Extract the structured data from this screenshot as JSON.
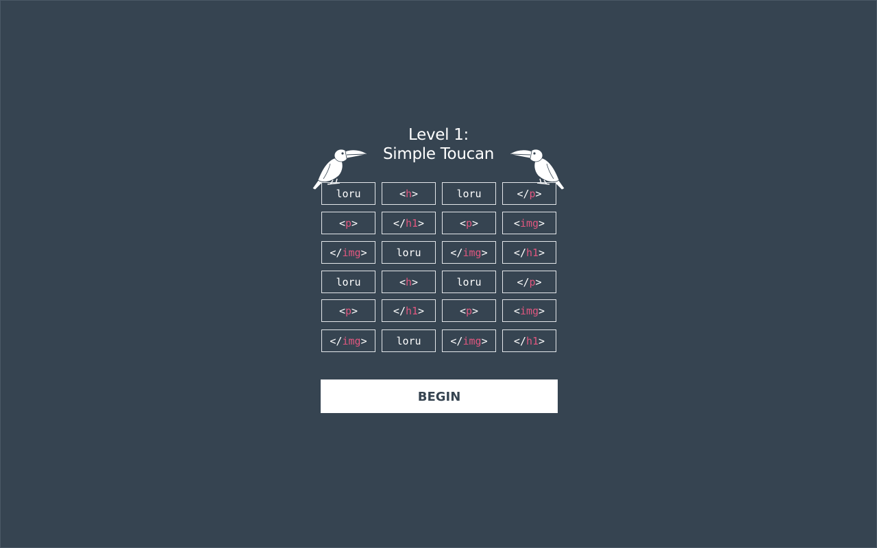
{
  "level": {
    "line1": "Level 1:",
    "line2": "Simple Toucan"
  },
  "board": {
    "rows": [
      [
        {
          "pre": "",
          "tag": "",
          "text": "loru"
        },
        {
          "pre": "<",
          "tag": "h",
          "post": ">"
        },
        {
          "pre": "",
          "tag": "",
          "text": "loru"
        },
        {
          "pre": "</",
          "tag": "p",
          "post": ">"
        }
      ],
      [
        {
          "pre": "<",
          "tag": "p",
          "post": ">"
        },
        {
          "pre": "</",
          "tag": "h1",
          "post": ">"
        },
        {
          "pre": "<",
          "tag": "p",
          "post": ">"
        },
        {
          "pre": "<",
          "tag": "img",
          "post": ">"
        }
      ],
      [
        {
          "pre": "</",
          "tag": "img",
          "post": ">"
        },
        {
          "pre": "",
          "tag": "",
          "text": "loru"
        },
        {
          "pre": "</",
          "tag": "img",
          "post": ">"
        },
        {
          "pre": "</",
          "tag": "h1",
          "post": ">"
        }
      ],
      [
        {
          "pre": "",
          "tag": "",
          "text": "loru"
        },
        {
          "pre": "<",
          "tag": "h",
          "post": ">"
        },
        {
          "pre": "",
          "tag": "",
          "text": "loru"
        },
        {
          "pre": "</",
          "tag": "p",
          "post": ">"
        }
      ],
      [
        {
          "pre": "<",
          "tag": "p",
          "post": ">"
        },
        {
          "pre": "</",
          "tag": "h1",
          "post": ">"
        },
        {
          "pre": "<",
          "tag": "p",
          "post": ">"
        },
        {
          "pre": "<",
          "tag": "img",
          "post": ">"
        }
      ],
      [
        {
          "pre": "</",
          "tag": "img",
          "post": ">"
        },
        {
          "pre": "",
          "tag": "",
          "text": "loru"
        },
        {
          "pre": "</",
          "tag": "img",
          "post": ">"
        },
        {
          "pre": "</",
          "tag": "h1",
          "post": ">"
        }
      ]
    ]
  },
  "begin_label": "BEGIN",
  "colors": {
    "background": "#364451",
    "tag_accent": "#e0577f",
    "text": "#ffffff"
  },
  "icons": {
    "left": "toucan-icon",
    "right": "toucan-icon"
  }
}
